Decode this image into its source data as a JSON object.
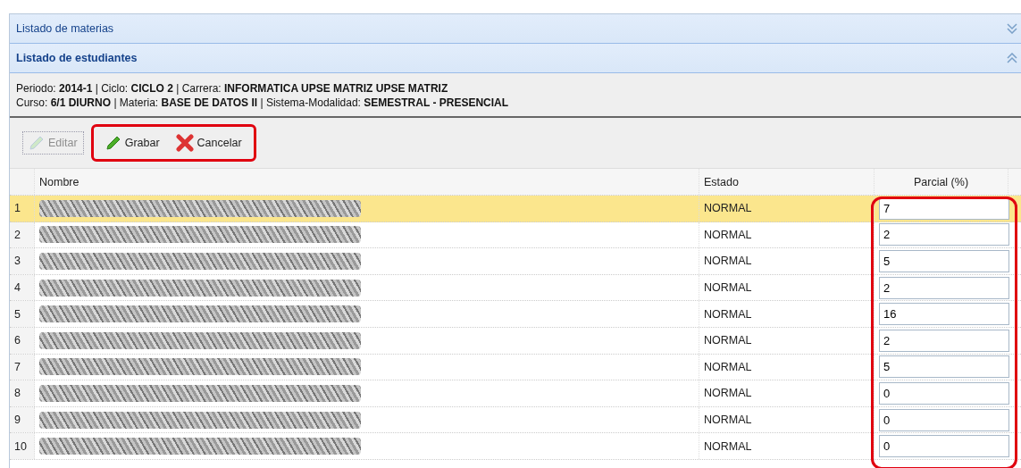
{
  "panels": [
    {
      "title": "Listado de materias",
      "expanded": false
    },
    {
      "title": "Listado de estudiantes",
      "expanded": true
    }
  ],
  "info_lines": [
    "Periodo: **2014-1** | Ciclo: **CICLO 2** | Carrera: **INFORMATICA UPSE MATRIZ UPSE MATRIZ**",
    "Curso: **6/1 DIURNO** | Materia: **BASE DE DATOS II** | Sistema-Modalidad: **SEMESTRAL - PRESENCIAL**"
  ],
  "toolbar": [
    {
      "label": "Editar",
      "kind": "edit",
      "disabled": true
    },
    {
      "label": "Grabar",
      "kind": "save",
      "disabled": false
    },
    {
      "label": "Cancelar",
      "kind": "cancel",
      "disabled": false
    }
  ],
  "table": {
    "columns": [
      "Nombre",
      "Estado",
      "Parcial (%)"
    ],
    "rows": [
      {
        "number": "1",
        "estado": "NORMAL",
        "parcial": "7",
        "selected": true
      },
      {
        "number": "2",
        "estado": "NORMAL",
        "parcial": "2",
        "selected": false
      },
      {
        "number": "3",
        "estado": "NORMAL",
        "parcial": "5",
        "selected": false
      },
      {
        "number": "4",
        "estado": "NORMAL",
        "parcial": "2",
        "selected": false
      },
      {
        "number": "5",
        "estado": "NORMAL",
        "parcial": "16",
        "selected": false
      },
      {
        "number": "6",
        "estado": "NORMAL",
        "parcial": "2",
        "selected": false
      },
      {
        "number": "7",
        "estado": "NORMAL",
        "parcial": "5",
        "selected": false
      },
      {
        "number": "8",
        "estado": "NORMAL",
        "parcial": "0",
        "selected": false
      },
      {
        "number": "9",
        "estado": "NORMAL",
        "parcial": "0",
        "selected": false
      },
      {
        "number": "10",
        "estado": "NORMAL",
        "parcial": "0",
        "selected": false
      }
    ]
  }
}
